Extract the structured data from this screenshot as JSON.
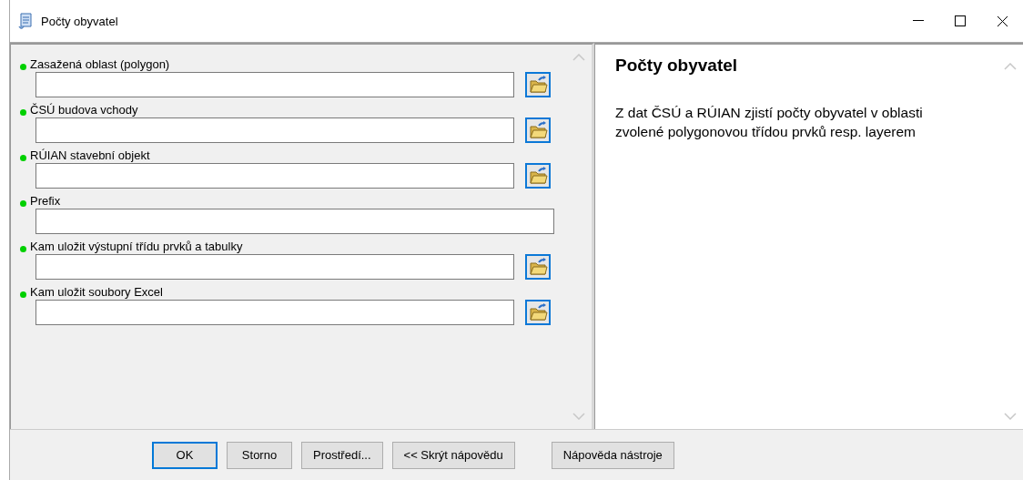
{
  "window": {
    "title": "Počty obyvatel"
  },
  "parameters": [
    {
      "label": "Zasažená oblast (polygon)",
      "required": true,
      "kind": "browse"
    },
    {
      "label": "ČSÚ budova vchody",
      "required": true,
      "kind": "browse"
    },
    {
      "label": "RÚIAN stavební objekt",
      "required": true,
      "kind": "browse"
    },
    {
      "label": "Prefix",
      "required": true,
      "kind": "text"
    },
    {
      "label": "Kam uložit výstupní třídu prvků a tabulky",
      "required": true,
      "kind": "browse"
    },
    {
      "label": "Kam uložit soubory Excel",
      "required": true,
      "kind": "browse"
    }
  ],
  "help": {
    "title": "Počty obyvatel",
    "text": "Z dat ČSÚ a RÚIAN zjistí počty obyvatel v oblasti zvolené polygonovou třídou prvků resp. layerem"
  },
  "buttons": [
    {
      "label": "OK",
      "default": true
    },
    {
      "label": "Storno",
      "default": false
    },
    {
      "label": "Prostředí...",
      "default": false
    },
    {
      "label": "<< Skrýt nápovědu",
      "default": false
    },
    {
      "label": "Nápověda nástroje",
      "default": false
    }
  ]
}
